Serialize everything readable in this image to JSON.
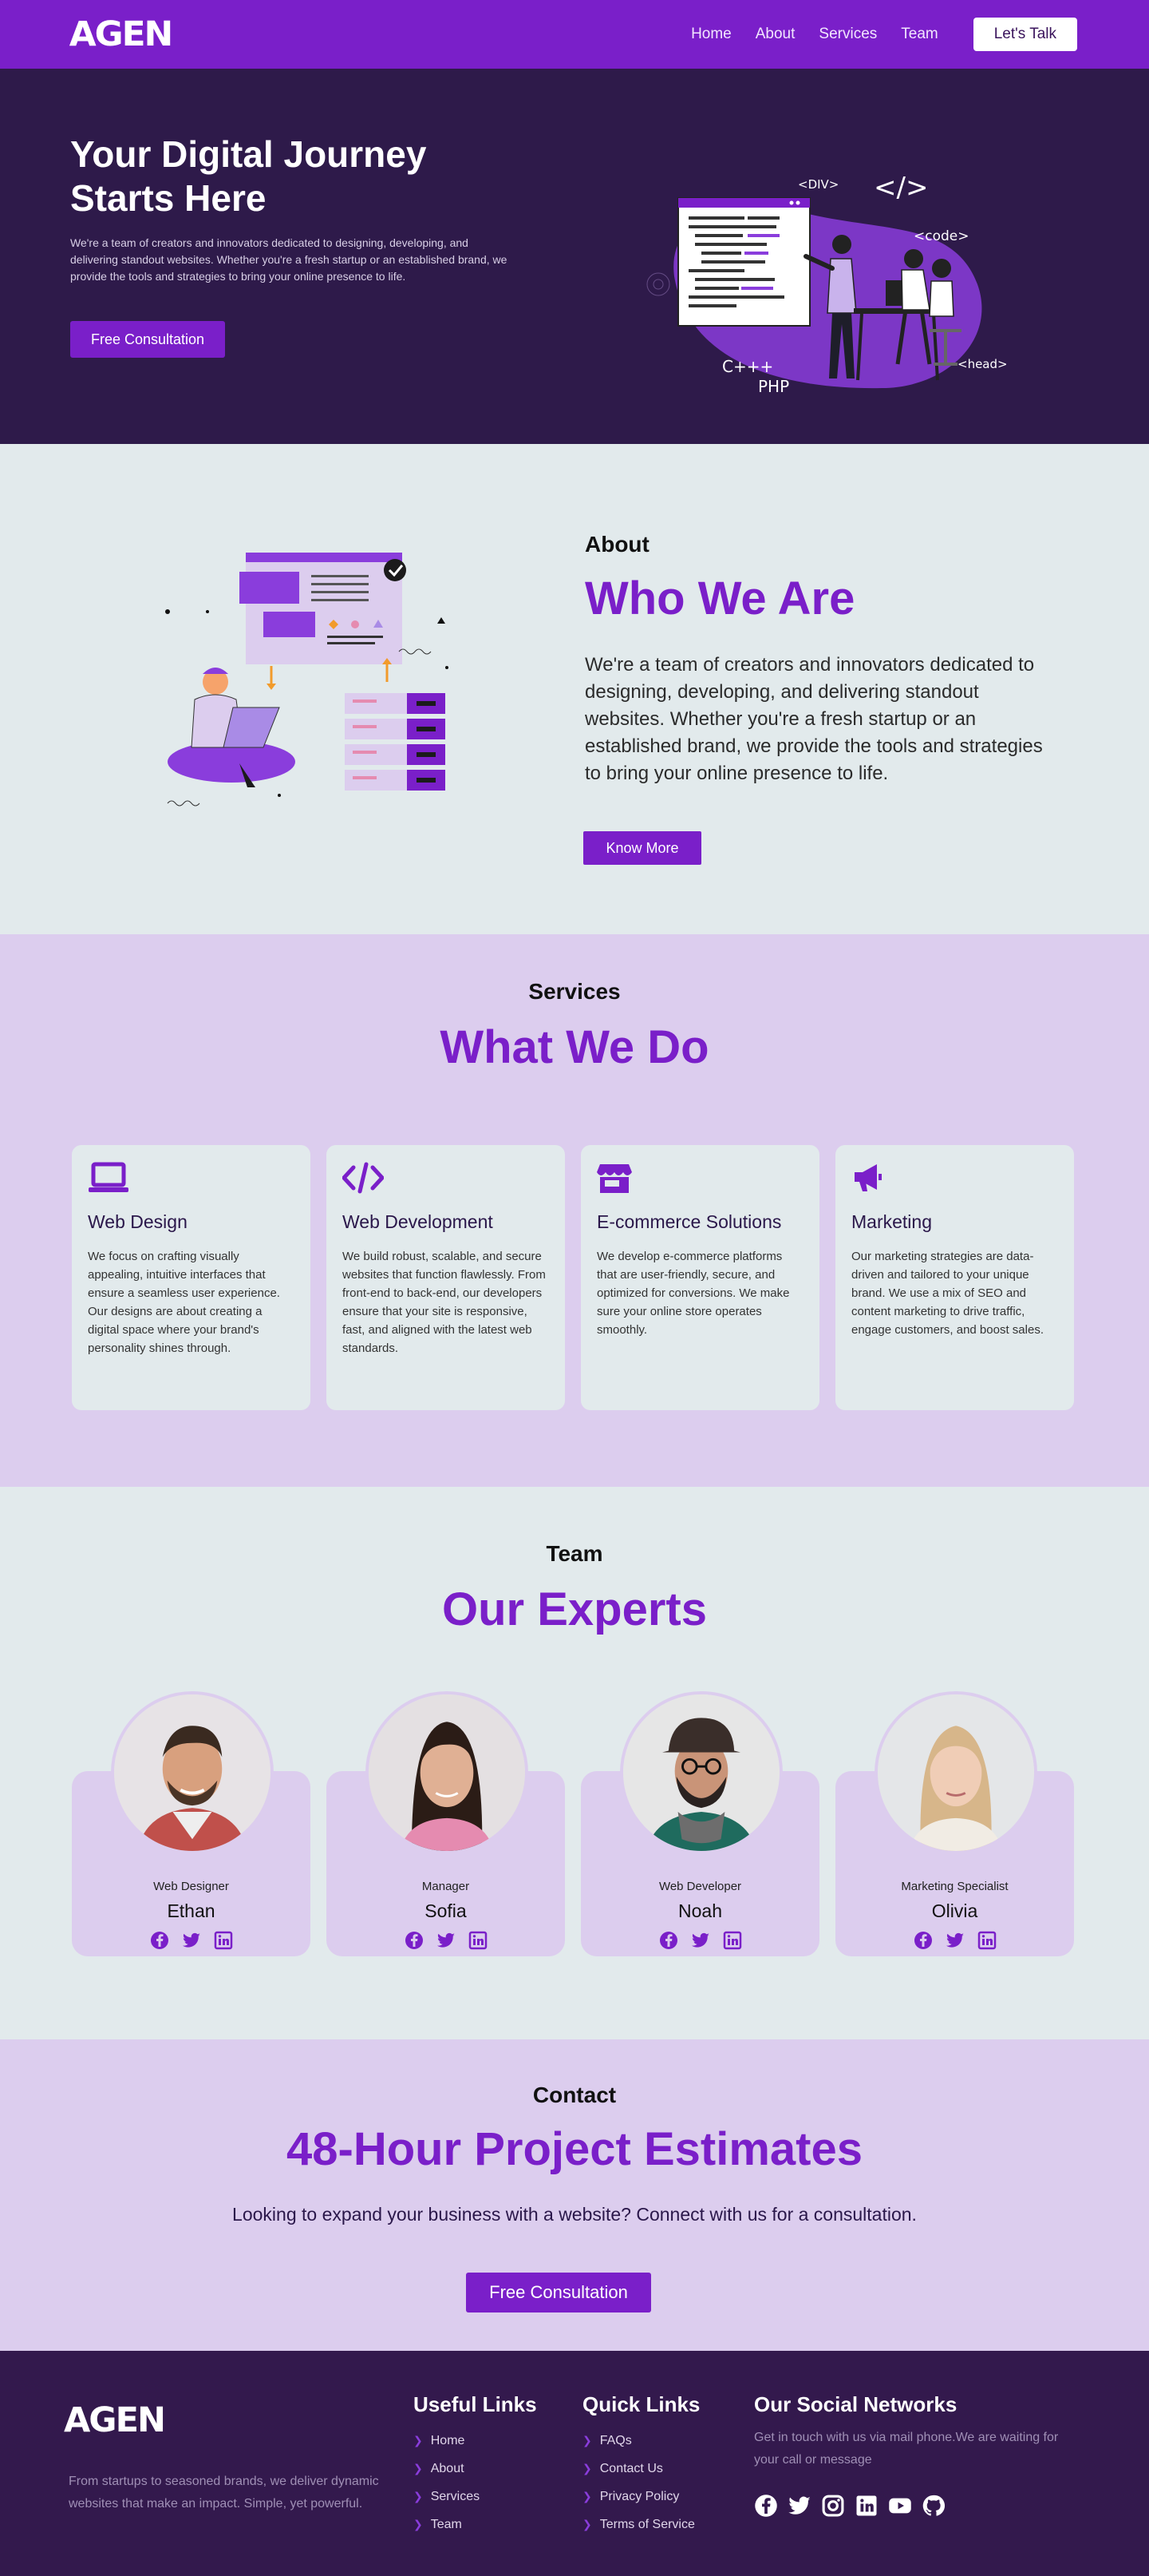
{
  "nav": {
    "logo": "AGEN",
    "links": [
      "Home",
      "About",
      "Services",
      "Team"
    ],
    "cta": "Let's Talk"
  },
  "hero": {
    "title": "Your Digital Journey Starts Here",
    "text": "We're a team of creators and innovators dedicated to designing, developing, and delivering standout websites. Whether you're a fresh startup or an established brand, we provide the tools and strategies to bring your online presence to life.",
    "button": "Free Consultation",
    "illustration_labels": [
      "<DIV>",
      "</>",
      "<code>",
      "C+++",
      "PHP",
      "<head>"
    ]
  },
  "about": {
    "kicker": "About",
    "title": "Who We Are",
    "text": "We're a team of creators and innovators dedicated to designing, developing, and delivering standout websites. Whether you're a fresh startup or an established brand, we provide the tools and strategies to bring your online presence to life.",
    "button": "Know More"
  },
  "services": {
    "kicker": "Services",
    "title": "What We Do",
    "cards": [
      {
        "icon": "laptop-icon",
        "title": "Web Design",
        "text": "We focus on crafting visually appealing, intuitive interfaces that ensure a seamless user experience. Our designs are about creating a digital space where your brand's personality shines through."
      },
      {
        "icon": "code-icon",
        "title": "Web Development",
        "text": "We build robust, scalable, and secure websites that function flawlessly. From front-end to back-end, our developers ensure that your site is responsive, fast, and aligned with the latest web standards."
      },
      {
        "icon": "store-icon",
        "title": "E-commerce Solutions",
        "text": "We develop e-commerce platforms that are user-friendly, secure, and optimized for conversions. We make sure your online store operates smoothly."
      },
      {
        "icon": "megaphone-icon",
        "title": "Marketing",
        "text": "Our marketing strategies are data-driven and tailored to your unique brand. We use a mix of SEO and content marketing to drive traffic, engage customers, and boost sales."
      }
    ]
  },
  "team": {
    "kicker": "Team",
    "title": "Our Experts",
    "members": [
      {
        "role": "Web Designer",
        "name": "Ethan"
      },
      {
        "role": "Manager",
        "name": "Sofia"
      },
      {
        "role": "Web Developer",
        "name": "Noah"
      },
      {
        "role": "Marketing Specialist",
        "name": "Olivia"
      }
    ]
  },
  "contact": {
    "kicker": "Contact",
    "title": "48-Hour Project Estimates",
    "text": "Looking to expand your business with a website? Connect with us for a consultation.",
    "button": "Free Consultation"
  },
  "footer": {
    "logo": "AGEN",
    "about": "From startups to seasoned brands, we deliver dynamic websites that make an impact. Simple, yet powerful.",
    "useful_title": "Useful Links",
    "useful_links": [
      "Home",
      "About",
      "Services",
      "Team"
    ],
    "quick_title": "Quick Links",
    "quick_links": [
      "FAQs",
      "Contact Us",
      "Privacy Policy",
      "Terms of Service"
    ],
    "social_title": "Our Social Networks",
    "social_text": "Get in touch with us via mail phone.We are waiting for your call or message"
  },
  "colors": {
    "primary": "#7a1fc9",
    "hero_bg": "#2e1a4a",
    "light_bg": "#e2eaec",
    "lilac_bg": "#dccdee",
    "footer_bg": "#33194d"
  }
}
